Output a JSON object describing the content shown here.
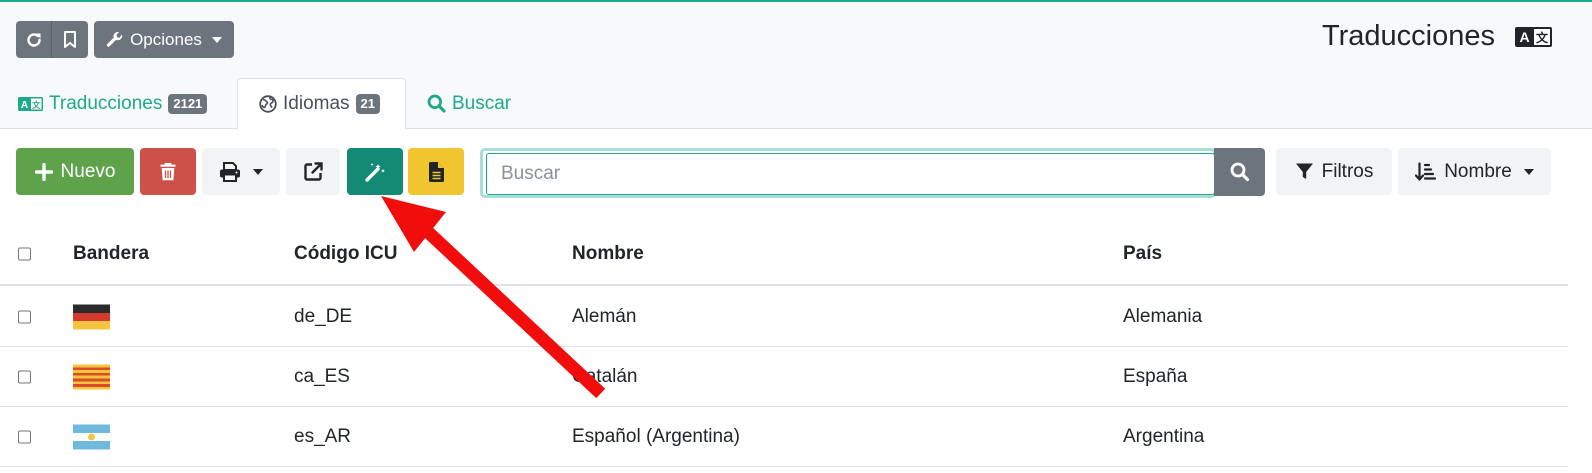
{
  "header": {
    "title": "Traducciones",
    "options_label": "Opciones",
    "icons": {
      "reload": "reload-icon",
      "bookmark": "bookmark-icon",
      "wrench": "wrench-icon",
      "translate": "translate-icon"
    }
  },
  "tabs": [
    {
      "label": "Traducciones",
      "count": "2121",
      "icon": "translate-icon"
    },
    {
      "label": "Idiomas",
      "count": "21",
      "icon": "globe-icon"
    },
    {
      "label": "Buscar",
      "icon": "search-icon"
    }
  ],
  "toolbar": {
    "new_label": "Nuevo",
    "search_placeholder": "Buscar",
    "filters_label": "Filtros",
    "sort_label": "Nombre"
  },
  "table": {
    "columns": [
      "Bandera",
      "Código ICU",
      "Nombre",
      "País"
    ],
    "rows": [
      {
        "flag": "Germany",
        "code": "de_DE",
        "name": "Alemán",
        "country": "Alemania"
      },
      {
        "flag": "Catalonia",
        "code": "ca_ES",
        "name": "Catalán",
        "country": "España"
      },
      {
        "flag": "Argentina",
        "code": "es_AR",
        "name": "Español (Argentina)",
        "country": "Argentina"
      }
    ]
  },
  "colors": {
    "accent": "#1fa98c",
    "new_button": "#5ea34a",
    "delete_button": "#cc5149",
    "wizard_button": "#138a73",
    "doc_button": "#f0c52e",
    "annotation_arrow": "#f20d0d"
  }
}
